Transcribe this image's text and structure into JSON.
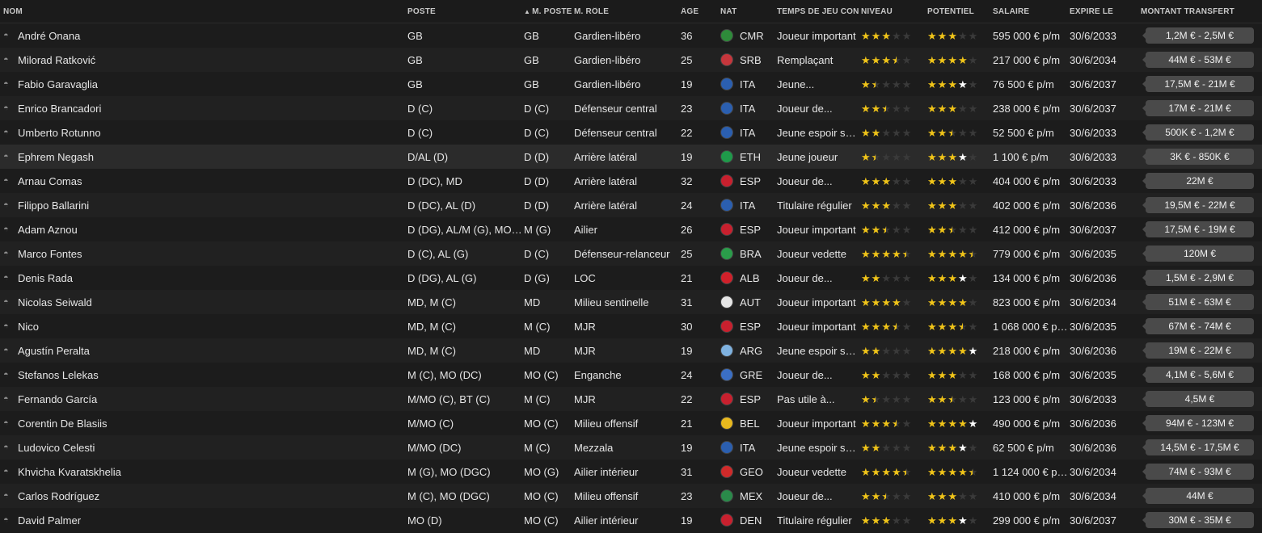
{
  "headers": {
    "nom": "NOM",
    "poste": "POSTE",
    "mposte": "M. POSTE",
    "mrole": "M. RÔLE",
    "age": "ÂGE",
    "nat": "NAT",
    "temps": "TEMPS DE JEU CON...",
    "niveau": "NIVEAU",
    "potentiel": "POTENTIEL",
    "salaire": "SALAIRE",
    "expire": "EXPIRE LE",
    "montant": "MONTANT TRANSFERT"
  },
  "sort_indicator": "▲",
  "colors": {
    "star_on": "#f0c419",
    "star_white": "#ffffff",
    "pill": "#4a4a4a"
  },
  "players": [
    {
      "nom": "André Onana",
      "poste": "GB",
      "mposte": "GB",
      "mrole": "Gardien-libéro",
      "age": "36",
      "nat": "CMR",
      "flag": "#2e8b3a",
      "temps": "Joueur important",
      "niveau": 3,
      "potentiel": 3,
      "salaire": "595 000 € p/m",
      "expire": "30/6/2033",
      "montant": "1,2M € - 2,5M €"
    },
    {
      "nom": "Milorad Ratković",
      "poste": "GB",
      "mposte": "GB",
      "mrole": "Gardien-libéro",
      "age": "25",
      "nat": "SRB",
      "flag": "#c6363c",
      "temps": "Remplaçant",
      "niveau": 3.5,
      "potentiel": 4,
      "salaire": "217 000 € p/m",
      "expire": "30/6/2034",
      "montant": "44M € - 53M €"
    },
    {
      "nom": "Fabio Garavaglia",
      "poste": "GB",
      "mposte": "GB",
      "mrole": "Gardien-libéro",
      "age": "19",
      "nat": "ITA",
      "flag": "#2b5fb0",
      "temps": "Jeune...",
      "niveau": 1.5,
      "potentiel": "3+w0.5+h0.5",
      "salaire": "76 500 € p/m",
      "expire": "30/6/2037",
      "montant": "17,5M € - 21M €"
    },
    {
      "nom": "Enrico Brancadori",
      "poste": "D (C)",
      "mposte": "D (C)",
      "mrole": "Défenseur central",
      "age": "23",
      "nat": "ITA",
      "flag": "#2b5fb0",
      "temps": "Joueur de...",
      "niveau": 2.5,
      "potentiel": 3,
      "salaire": "238 000 € p/m",
      "expire": "30/6/2037",
      "montant": "17M € - 21M €"
    },
    {
      "nom": "Umberto Rotunno",
      "poste": "D (C)",
      "mposte": "D (C)",
      "mrole": "Défenseur central",
      "age": "22",
      "nat": "ITA",
      "flag": "#2b5fb0",
      "temps": "Jeune espoir su...",
      "niveau": 2,
      "potentiel": 2.5,
      "salaire": "52 500 € p/m",
      "expire": "30/6/2033",
      "montant": "500K € - 1,2M €"
    },
    {
      "nom": "Ephrem Negash",
      "poste": "D/AL (D)",
      "mposte": "D (D)",
      "mrole": "Arrière latéral",
      "age": "19",
      "nat": "ETH",
      "flag": "#1f9a4a",
      "temps": "Jeune joueur",
      "niveau": 1.5,
      "potentiel": "3+w1",
      "salaire": "1 100 € p/m",
      "expire": "30/6/2033",
      "montant": "3K € - 850K €",
      "highlight": true
    },
    {
      "nom": "Arnau Comas",
      "poste": "D (DC), MD",
      "mposte": "D (D)",
      "mrole": "Arrière latéral",
      "age": "32",
      "nat": "ESP",
      "flag": "#c8202e",
      "temps": "Joueur de...",
      "niveau": 3,
      "potentiel": 3,
      "salaire": "404 000 € p/m",
      "expire": "30/6/2033",
      "montant": "22M €"
    },
    {
      "nom": "Filippo Ballarini",
      "poste": "D (DC), AL (D)",
      "mposte": "D (D)",
      "mrole": "Arrière latéral",
      "age": "24",
      "nat": "ITA",
      "flag": "#2b5fb0",
      "temps": "Titulaire régulier",
      "niveau": 3,
      "potentiel": 3,
      "salaire": "402 000 € p/m",
      "expire": "30/6/2036",
      "montant": "19,5M € - 22M €"
    },
    {
      "nom": "Adam Aznou",
      "poste": "D (DG), AL/M (G), MO (...",
      "mposte": "M (G)",
      "mrole": "Ailier",
      "age": "26",
      "nat": "ESP",
      "flag": "#c8202e",
      "temps": "Joueur important",
      "niveau": 2.5,
      "potentiel": 2.5,
      "salaire": "412 000 € p/m",
      "expire": "30/6/2037",
      "montant": "17,5M € - 19M €"
    },
    {
      "nom": "Marco Fontes",
      "poste": "D (C), AL (G)",
      "mposte": "D (C)",
      "mrole": "Défenseur-relanceur",
      "age": "25",
      "nat": "BRA",
      "flag": "#2a9d4a",
      "temps": "Joueur vedette",
      "niveau": 4.5,
      "potentiel": 4.5,
      "salaire": "779 000 € p/m",
      "expire": "30/6/2035",
      "montant": "120M €"
    },
    {
      "nom": "Denis Rada",
      "poste": "D (DG), AL (G)",
      "mposte": "D (G)",
      "mrole": "LOC",
      "age": "21",
      "nat": "ALB",
      "flag": "#d0202a",
      "temps": "Joueur de...",
      "niveau": 2,
      "potentiel": "3+w1",
      "salaire": "134 000 € p/m",
      "expire": "30/6/2036",
      "montant": "1,5M € - 2,9M €"
    },
    {
      "nom": "Nicolas Seiwald",
      "poste": "MD, M (C)",
      "mposte": "MD",
      "mrole": "Milieu sentinelle",
      "age": "31",
      "nat": "AUT",
      "flag": "#e6e6e6",
      "temps": "Joueur important",
      "niveau": 4,
      "potentiel": 4,
      "salaire": "823 000 € p/m",
      "expire": "30/6/2034",
      "montant": "51M € - 63M €"
    },
    {
      "nom": "Nico",
      "poste": "MD, M (C)",
      "mposte": "M (C)",
      "mrole": "MJR",
      "age": "30",
      "nat": "ESP",
      "flag": "#c8202e",
      "temps": "Joueur important",
      "niveau": 3.5,
      "potentiel": 3.5,
      "salaire": "1 068 000 € p/m",
      "expire": "30/6/2035",
      "montant": "67M € - 74M €"
    },
    {
      "nom": "Agustín Peralta",
      "poste": "MD, M (C)",
      "mposte": "MD",
      "mrole": "MJR",
      "age": "19",
      "nat": "ARG",
      "flag": "#7fb2e0",
      "temps": "Jeune espoir su...",
      "niveau": 2,
      "potentiel": "4+w1",
      "salaire": "218 000 € p/m",
      "expire": "30/6/2036",
      "montant": "19M € - 22M €"
    },
    {
      "nom": "Stefanos Lelekas",
      "poste": "M (C), MO (DC)",
      "mposte": "MO (C)",
      "mrole": "Enganche",
      "age": "24",
      "nat": "GRE",
      "flag": "#3b6fc4",
      "temps": "Joueur de...",
      "niveau": 2,
      "potentiel": 3,
      "salaire": "168 000 € p/m",
      "expire": "30/6/2035",
      "montant": "4,1M € - 5,6M €"
    },
    {
      "nom": "Fernando García",
      "poste": "M/MO (C), BT (C)",
      "mposte": "M (C)",
      "mrole": "MJR",
      "age": "22",
      "nat": "ESP",
      "flag": "#c8202e",
      "temps": "Pas utile à...",
      "niveau": 1.5,
      "potentiel": 2.5,
      "salaire": "123 000 € p/m",
      "expire": "30/6/2033",
      "montant": "4,5M €"
    },
    {
      "nom": "Corentin De Blasiis",
      "poste": "M/MO (C)",
      "mposte": "MO (C)",
      "mrole": "Milieu offensif",
      "age": "21",
      "nat": "BEL",
      "flag": "#e8b81e",
      "temps": "Joueur important",
      "niveau": 3.5,
      "potentiel": "4+w1",
      "salaire": "490 000 € p/m",
      "expire": "30/6/2036",
      "montant": "94M € - 123M €"
    },
    {
      "nom": "Ludovico Celesti",
      "poste": "M/MO (DC)",
      "mposte": "M (C)",
      "mrole": "Mezzala",
      "age": "19",
      "nat": "ITA",
      "flag": "#2b5fb0",
      "temps": "Jeune espoir su...",
      "niveau": 2,
      "potentiel": "3+w0.5+h0.5",
      "salaire": "62 500 € p/m",
      "expire": "30/6/2036",
      "montant": "14,5M € - 17,5M €"
    },
    {
      "nom": "Khvicha Kvaratskhelia",
      "poste": "M (G), MO (DGC)",
      "mposte": "MO (G)",
      "mrole": "Ailier intérieur",
      "age": "31",
      "nat": "GEO",
      "flag": "#d02a2a",
      "temps": "Joueur vedette",
      "niveau": 4.5,
      "potentiel": 4.5,
      "salaire": "1 124 000 € p/m",
      "expire": "30/6/2034",
      "montant": "74M € - 93M €"
    },
    {
      "nom": "Carlos Rodríguez",
      "poste": "M (C), MO (DGC)",
      "mposte": "MO (C)",
      "mrole": "Milieu offensif",
      "age": "23",
      "nat": "MEX",
      "flag": "#2a8a4a",
      "temps": "Joueur de...",
      "niveau": 2.5,
      "potentiel": 3,
      "salaire": "410 000 € p/m",
      "expire": "30/6/2034",
      "montant": "44M €"
    },
    {
      "nom": "David Palmer",
      "poste": "MO (D)",
      "mposte": "MO (C)",
      "mrole": "Ailier intérieur",
      "age": "19",
      "nat": "DEN",
      "flag": "#c8202e",
      "temps": "Titulaire régulier",
      "niveau": 3,
      "potentiel": "3+w0.5+h0.5",
      "salaire": "299 000 € p/m",
      "expire": "30/6/2037",
      "montant": "30M € - 35M €"
    }
  ]
}
